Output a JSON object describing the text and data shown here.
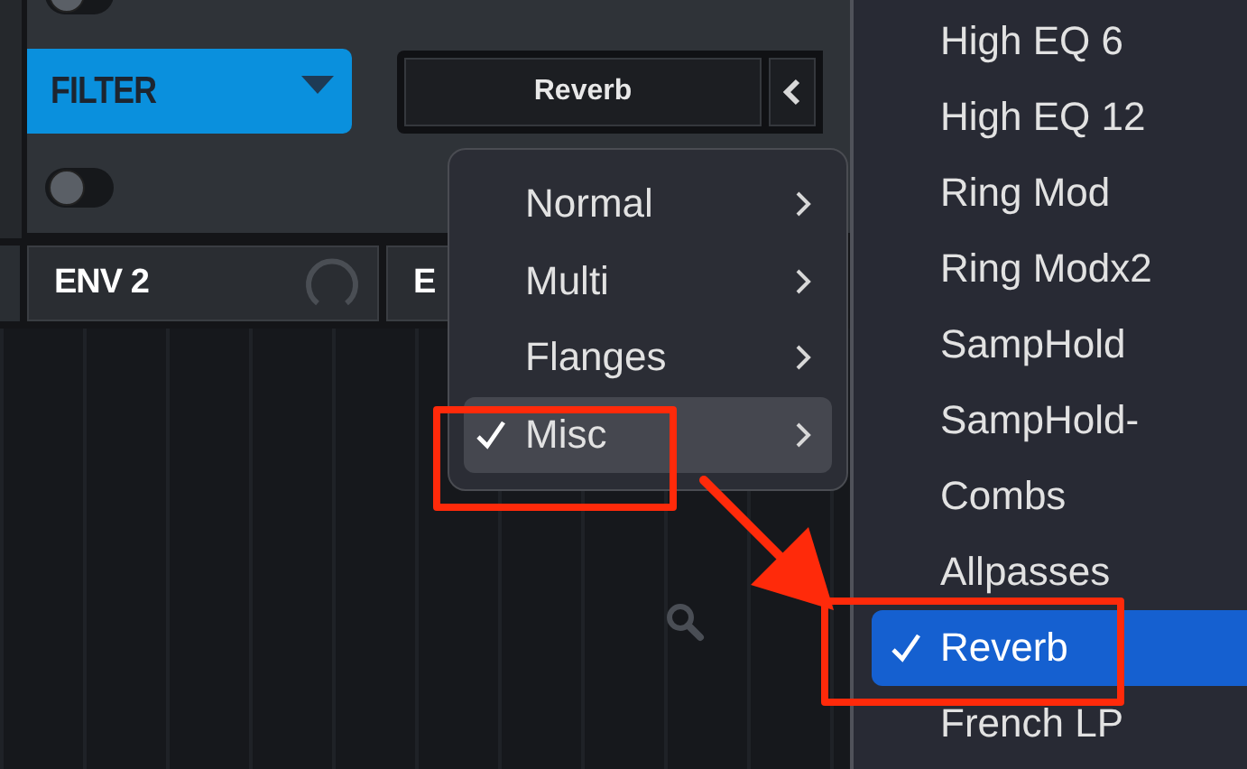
{
  "filter_section": {
    "label": "FILTER",
    "effect_value": "Reverb"
  },
  "toggles": [
    {
      "on": false
    },
    {
      "on": false
    }
  ],
  "env_tabs": [
    {
      "label": "ENV 2",
      "kind": "knob"
    },
    {
      "label": "E",
      "kind": "plain"
    }
  ],
  "category_menu": {
    "items": [
      {
        "label": "Normal",
        "selected": false
      },
      {
        "label": "Multi",
        "selected": false
      },
      {
        "label": "Flanges",
        "selected": false
      },
      {
        "label": "Misc",
        "selected": true
      }
    ]
  },
  "effect_menu": {
    "items": [
      {
        "label": "High EQ 6",
        "selected": false
      },
      {
        "label": "High EQ 12",
        "selected": false
      },
      {
        "label": "Ring Mod",
        "selected": false
      },
      {
        "label": "Ring Modx2",
        "selected": false
      },
      {
        "label": "SampHold",
        "selected": false
      },
      {
        "label": "SampHold-",
        "selected": false
      },
      {
        "label": "Combs",
        "selected": false
      },
      {
        "label": "Allpasses",
        "selected": false
      },
      {
        "label": "Reverb",
        "selected": true
      },
      {
        "label": "French LP",
        "selected": false
      }
    ]
  }
}
